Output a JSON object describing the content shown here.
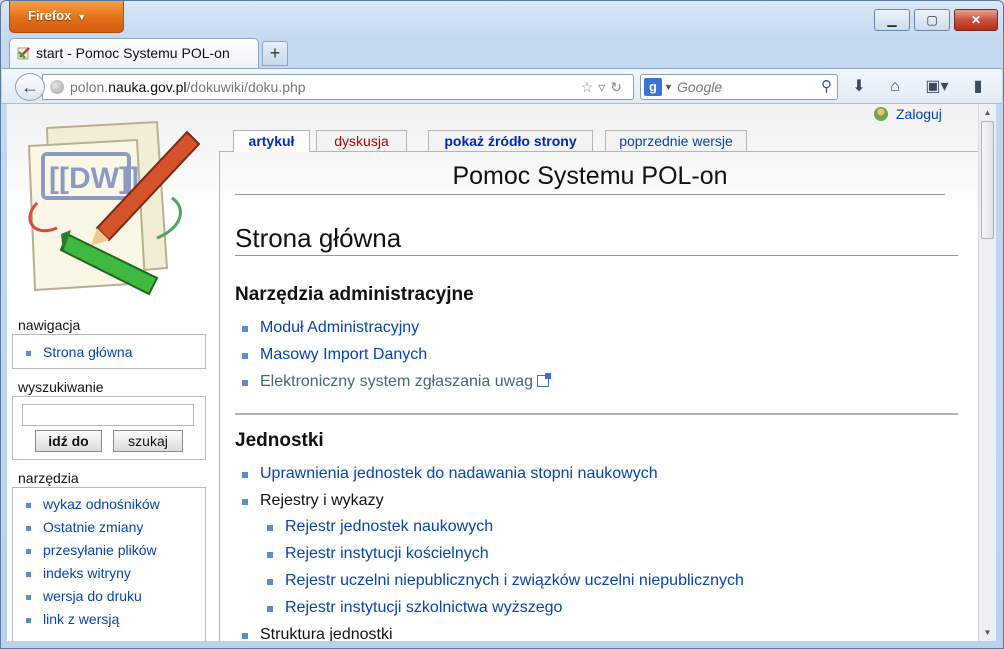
{
  "browser": {
    "menu_button": "Firefox",
    "window_controls": {
      "minimize": "▁",
      "maximize": "▢",
      "close": "✕"
    },
    "tab_title": "start - Pomoc Systemu POL-on",
    "new_tab": "+",
    "url_prefix": "polon.",
    "url_host": "nauka.gov.pl",
    "url_path": "/dokuwiki/doku.php",
    "url_tools": "☆▿↻",
    "search_placeholder": "Google",
    "search_engine_letter": "g"
  },
  "page": {
    "login_label": "Zaloguj",
    "site_title": "Pomoc Systemu POL-on",
    "page_tabs": [
      "artykuł",
      "dyskusja",
      "pokaż źródło strony",
      "poprzednie wersje"
    ],
    "heading": "Strona główna",
    "sections": [
      {
        "title": "Narzędzia administracyjne",
        "items": [
          "Moduł Administracyjny",
          "Masowy Import Danych",
          "Elektroniczny system zgłaszania uwag"
        ]
      },
      {
        "title": "Jednostki",
        "items": [
          "Uprawnienia jednostek do nadawania stopni naukowych",
          "Rejestry i wykazy",
          "Rejestr jednostek naukowych",
          "Rejestr instytucji kościelnych",
          "Rejestr uczelni niepublicznych i związków uczelni niepublicznych",
          "Rejestr instytucji szkolnictwa wyższego",
          "Struktura jednostki"
        ]
      }
    ]
  },
  "sidebar": {
    "nav_head": "nawigacja",
    "nav_items": [
      "Strona główna"
    ],
    "search_head": "wyszukiwanie",
    "go_button": "idź do",
    "search_button": "szukaj",
    "tools_head": "narzędzia",
    "tools_items": [
      "wykaz odnośników",
      "Ostatnie zmiany",
      "przesyłanie plików",
      "indeks witryny",
      "wersja do druku",
      "link z wersją"
    ]
  }
}
